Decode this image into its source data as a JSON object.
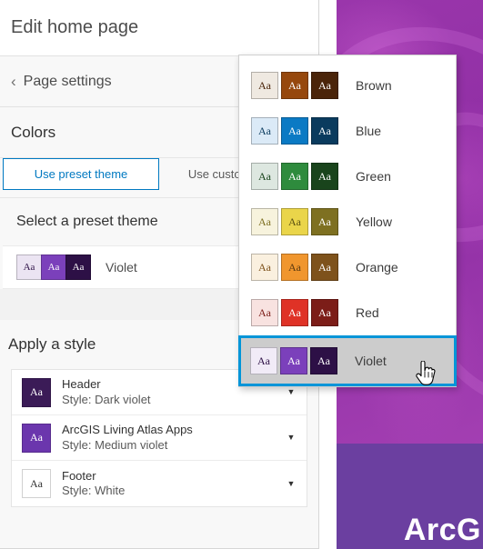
{
  "panel": {
    "title": "Edit home page",
    "back_icon": "chevron-left-icon",
    "subheader": "Page settings",
    "colors_section": "Colors",
    "tabs": [
      {
        "label": "Use preset theme",
        "active": true
      },
      {
        "label": "Use custom theme",
        "active": false
      }
    ],
    "select_preset_heading": "Select a preset theme",
    "selected_preset": {
      "name": "Violet",
      "swatches": [
        "#ebe4f2",
        "#7b40bb",
        "#2d1046"
      ],
      "swatch_text": "Aa",
      "text_colors": [
        "#2d1046",
        "#ffffff",
        "#ffffff"
      ]
    },
    "apply_style_heading": "Apply a style",
    "styles": [
      {
        "name": "Header",
        "style_label": "Style: Dark violet",
        "chip_bg": "#3b1b57",
        "chip_fg": "#ffffff",
        "chip_text": "Aa",
        "caret_icon": "chevron-down-icon"
      },
      {
        "name": "ArcGIS Living Atlas Apps",
        "style_label": "Style: Medium violet",
        "chip_bg": "#6b36ad",
        "chip_fg": "#ffffff",
        "chip_text": "Aa",
        "caret_icon": "chevron-down-icon"
      },
      {
        "name": "Footer",
        "style_label": "Style: White",
        "chip_bg": "#ffffff",
        "chip_fg": "#323232",
        "chip_text": "Aa",
        "caret_icon": "chevron-down-icon"
      }
    ]
  },
  "theme_menu": {
    "items": [
      {
        "name": "Brown",
        "selected": false,
        "swatches": [
          "#efe9e1",
          "#96480d",
          "#4a2409"
        ],
        "text_colors": [
          "#4a2409",
          "#ffffff",
          "#ffffff"
        ],
        "swatch_text": "Aa"
      },
      {
        "name": "Blue",
        "selected": false,
        "swatches": [
          "#dbeaf7",
          "#0b7ac4",
          "#0a3b5e"
        ],
        "text_colors": [
          "#0a3b5e",
          "#ffffff",
          "#ffffff"
        ],
        "swatch_text": "Aa"
      },
      {
        "name": "Green",
        "selected": false,
        "swatches": [
          "#dde7e0",
          "#2e8b3d",
          "#19441c"
        ],
        "text_colors": [
          "#19441c",
          "#ffffff",
          "#ffffff"
        ],
        "swatch_text": "Aa"
      },
      {
        "name": "Yellow",
        "selected": false,
        "swatches": [
          "#f7f3dd",
          "#ead54a",
          "#7e7021"
        ],
        "text_colors": [
          "#7e7021",
          "#5c5212",
          "#ffffff"
        ],
        "swatch_text": "Aa"
      },
      {
        "name": "Orange",
        "selected": false,
        "swatches": [
          "#faf0df",
          "#f0962e",
          "#7e521b"
        ],
        "text_colors": [
          "#7e521b",
          "#5c3a10",
          "#ffffff"
        ],
        "swatch_text": "Aa"
      },
      {
        "name": "Red",
        "selected": false,
        "swatches": [
          "#f8e2e0",
          "#df3226",
          "#7c1d18"
        ],
        "text_colors": [
          "#7c1d18",
          "#ffffff",
          "#ffffff"
        ],
        "swatch_text": "Aa"
      },
      {
        "name": "Violet",
        "selected": true,
        "swatches": [
          "#f1ebf7",
          "#7b40bb",
          "#2d1046"
        ],
        "text_colors": [
          "#2d1046",
          "#ffffff",
          "#ffffff"
        ],
        "swatch_text": "Aa"
      }
    ]
  },
  "preview": {
    "site_title": "ArcG",
    "banner_color": "#9a36ab",
    "body_color": "#6b3fa0"
  },
  "colors": {
    "accent_blue": "#0079c1",
    "selection_blue": "#0095d8",
    "selection_fill": "#cccccc"
  },
  "cursor": {
    "icon": "pointing-hand-cursor"
  }
}
